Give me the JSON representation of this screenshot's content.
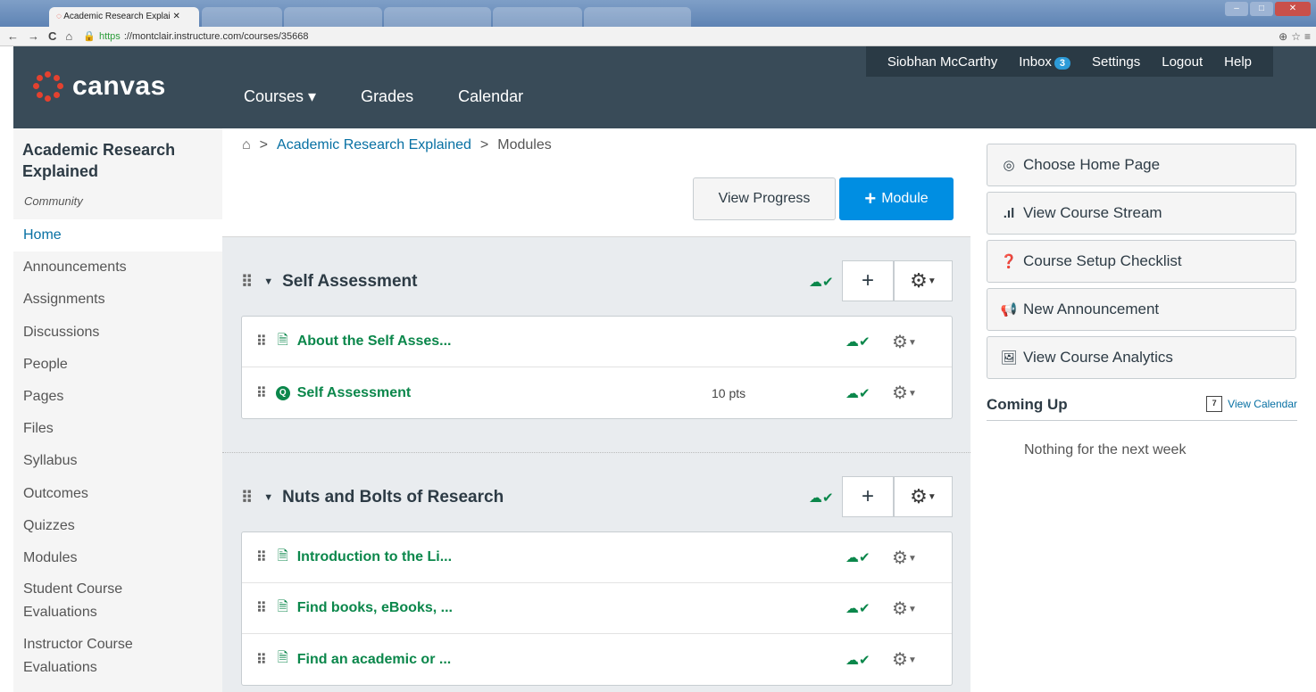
{
  "browser": {
    "active_tab": "Academic Research Explai",
    "url_scheme": "https",
    "url_rest": "://montclair.instructure.com/courses/35668",
    "nav_back": "←",
    "nav_fwd": "→",
    "nav_reload": "C",
    "nav_home": "⌂"
  },
  "header": {
    "logo_text": "canvas",
    "user_name": "Siobhan McCarthy",
    "inbox_label": "Inbox",
    "inbox_count": "3",
    "settings_label": "Settings",
    "logout_label": "Logout",
    "help_label": "Help",
    "nav": {
      "courses": "Courses ▾",
      "grades": "Grades",
      "calendar": "Calendar"
    }
  },
  "sidebar": {
    "course_title": "Academic Research Explained",
    "course_sub": "Community",
    "items": [
      {
        "label": "Home",
        "active": true
      },
      {
        "label": "Announcements"
      },
      {
        "label": "Assignments"
      },
      {
        "label": "Discussions"
      },
      {
        "label": "People"
      },
      {
        "label": "Pages"
      },
      {
        "label": "Files"
      },
      {
        "label": "Syllabus"
      },
      {
        "label": "Outcomes"
      },
      {
        "label": "Quizzes"
      },
      {
        "label": "Modules"
      },
      {
        "label": "Student Course Evaluations"
      },
      {
        "label": "Instructor Course Evaluations"
      }
    ]
  },
  "breadcrumb": {
    "home_icon": "⌂",
    "sep": ">",
    "course": "Academic Research Explained",
    "page": "Modules"
  },
  "toolbar": {
    "view_progress": "View Progress",
    "module_plus": "+",
    "module_label": "Module"
  },
  "modules": [
    {
      "title": "Self Assessment",
      "items": [
        {
          "title": "About the Self Asses...",
          "type": "page",
          "points": ""
        },
        {
          "title": "Self Assessment",
          "type": "quiz",
          "points": "10 pts"
        }
      ]
    },
    {
      "title": "Nuts and Bolts of Research",
      "items": [
        {
          "title": "Introduction to the Li...",
          "type": "page",
          "points": ""
        },
        {
          "title": "Find books, eBooks, ...",
          "type": "page",
          "points": ""
        },
        {
          "title": "Find an academic or ...",
          "type": "page",
          "points": ""
        }
      ]
    }
  ],
  "right_sidebar": {
    "buttons": [
      "Choose Home Page",
      "View Course Stream",
      "Course Setup Checklist",
      "New Announcement",
      "View Course Analytics"
    ],
    "coming_up": "Coming Up",
    "calendar_day": "7",
    "view_calendar": "View Calendar",
    "nothing": "Nothing for the next week"
  },
  "colors": {
    "header_bg": "#394b58",
    "accent": "#008ee2",
    "published": "#0b874b",
    "link": "#0770a3"
  }
}
